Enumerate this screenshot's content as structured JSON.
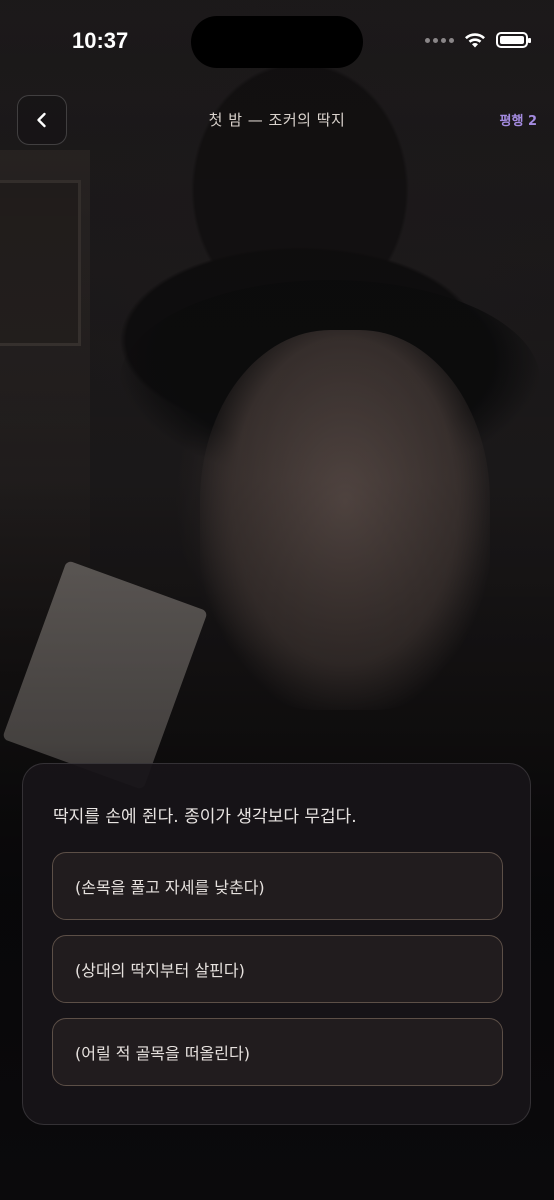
{
  "status_bar": {
    "time": "10:37"
  },
  "header": {
    "title": "첫 밤 — 조커의 딱지",
    "badge": "평행 2"
  },
  "scene": {
    "narration": "딱지를 손에 쥔다. 종이가 생각보다 무겁다.",
    "choices": [
      {
        "label": "(손목을 풀고 자세를 낮춘다)"
      },
      {
        "label": "(상대의 딱지부터 살핀다)"
      },
      {
        "label": "(어릴 적 골목을 떠올린다)"
      }
    ]
  },
  "colors": {
    "accent": "#a48be0",
    "choice_border": "#5c4f47",
    "panel_bg": "#181519"
  },
  "icons": {
    "back": "chevron-left-icon",
    "wifi": "wifi-icon",
    "battery": "battery-icon",
    "signal": "signal-dots-icon"
  }
}
